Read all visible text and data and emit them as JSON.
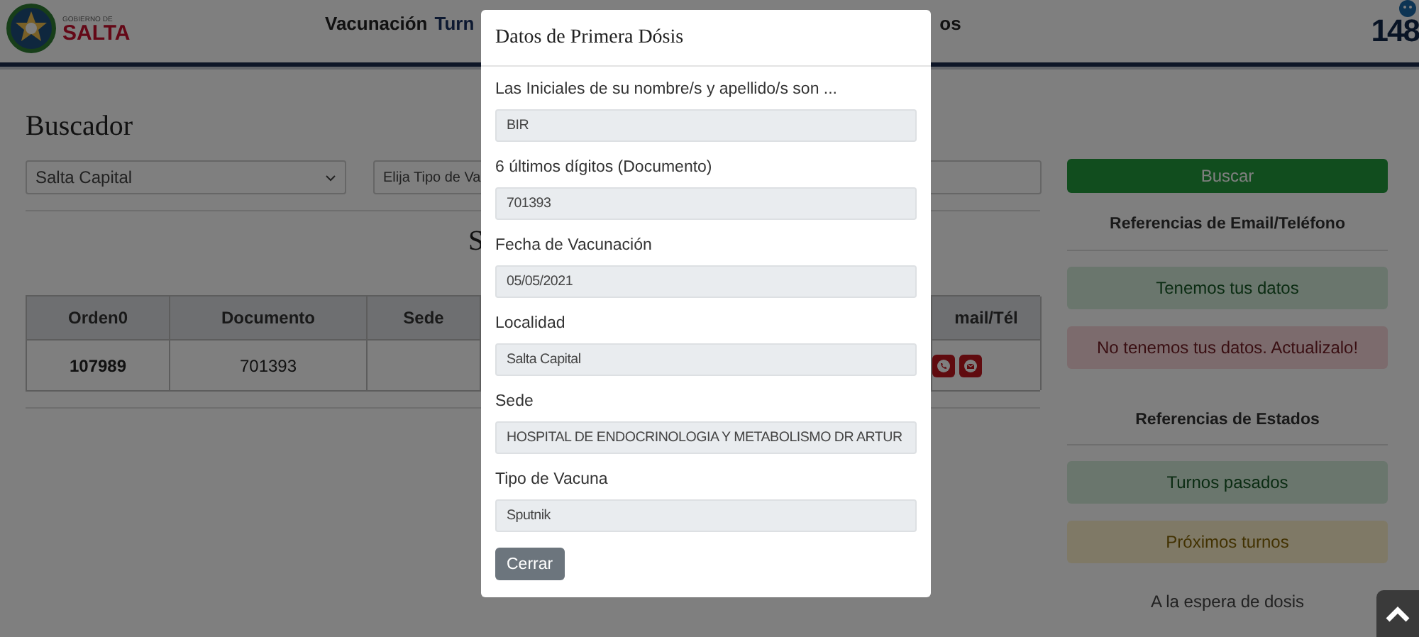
{
  "header": {
    "logo_top": "GOBIERNO DE",
    "logo_name": "SALTA",
    "nav": [
      {
        "label": "Vacunación",
        "selected": false
      },
      {
        "label": "Turn",
        "selected": true
      },
      {
        "label": "os",
        "selected": false
      }
    ],
    "hotline": "148"
  },
  "search": {
    "title": "Buscador",
    "location_select": "Salta Capital",
    "vaccine_select": "Elija Tipo de Va",
    "button": "Buscar"
  },
  "results": {
    "heading": "S",
    "columns": [
      "Orden0",
      "Documento",
      "Sede",
      "mail/Tél"
    ],
    "rows": [
      {
        "orden": "107989",
        "documento": "701393"
      }
    ]
  },
  "email_refs": {
    "title": "Referencias de Email/Teléfono",
    "items": [
      {
        "label": "Tenemos tus datos",
        "kind": "success"
      },
      {
        "label": "No tenemos tus datos. Actualizalo!",
        "kind": "danger"
      }
    ]
  },
  "state_refs": {
    "title": "Referencias de Estados",
    "items": [
      {
        "label": "Turnos pasados",
        "kind": "success"
      },
      {
        "label": "Próximos turnos",
        "kind": "warning"
      },
      {
        "label": "A la espera de dosis",
        "kind": "plain"
      }
    ]
  },
  "modal": {
    "title": "Datos de Primera Dósis",
    "fields": [
      {
        "label": "Las Iniciales de su nombre/s y apellido/s son ...",
        "value": "BIR"
      },
      {
        "label": "6 últimos dígitos (Documento)",
        "value": "701393"
      },
      {
        "label": "Fecha de Vacunación",
        "value": "05/05/2021"
      },
      {
        "label": "Localidad",
        "value": "Salta Capital"
      },
      {
        "label": "Sede",
        "value": "HOSPITAL DE ENDOCRINOLOGIA Y METABOLISMO DR ARTUR"
      },
      {
        "label": "Tipo de Vacuna",
        "value": "Sputnik"
      }
    ],
    "close_button": "Cerrar"
  }
}
